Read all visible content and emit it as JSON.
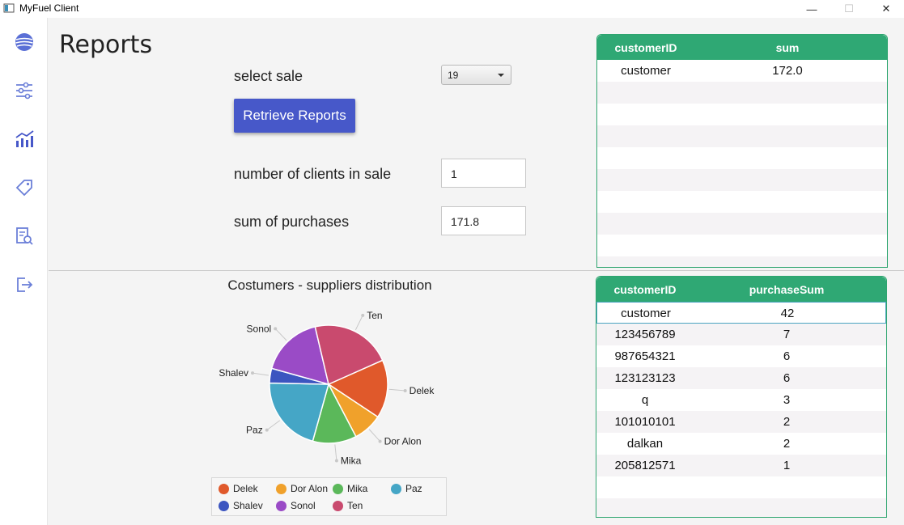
{
  "window": {
    "title": "MyFuel Client",
    "minimize": "—",
    "maximize": "☐",
    "close": "✕"
  },
  "sidebar": {
    "icons": [
      "globe-icon",
      "sliders-icon",
      "chart-icon",
      "tag-icon",
      "report-search-icon",
      "logout-icon"
    ],
    "active": "chart-icon",
    "icon_color": "#5a6fd6"
  },
  "page": {
    "title": "Reports",
    "select_sale_label": "select sale",
    "select_sale_value": "19",
    "retrieve_button": "Retrieve Reports",
    "clients_label": "number of clients in sale",
    "clients_value": "1",
    "sum_label": "sum of purchases",
    "sum_value": "171.8"
  },
  "top_table": {
    "columns": [
      "customerID",
      "sum"
    ],
    "rows": [
      [
        "customer",
        "172.0"
      ]
    ]
  },
  "bottom_table": {
    "columns": [
      "customerID",
      "purchaseSum"
    ],
    "rows": [
      [
        "customer",
        "42"
      ],
      [
        "123456789",
        "7"
      ],
      [
        "987654321",
        "6"
      ],
      [
        "123123123",
        "6"
      ],
      [
        "q",
        "3"
      ],
      [
        "101010101",
        "2"
      ],
      [
        "dalkan",
        "2"
      ],
      [
        "205812571",
        "1"
      ]
    ]
  },
  "chart_data": {
    "type": "pie",
    "title": "Costumers - suppliers distribution",
    "slices": [
      {
        "label": "Delek",
        "value": 16,
        "color": "#e0592b"
      },
      {
        "label": "Dor Alon",
        "value": 8,
        "color": "#f0a12b"
      },
      {
        "label": "Mika",
        "value": 12,
        "color": "#5bb85a"
      },
      {
        "label": "Paz",
        "value": 21,
        "color": "#45a6c6"
      },
      {
        "label": "Shalev",
        "value": 4,
        "color": "#3c55c0"
      },
      {
        "label": "Sonol",
        "value": 17,
        "color": "#9a4bc6"
      },
      {
        "label": "Ten",
        "value": 22,
        "color": "#c94a6e"
      }
    ],
    "legend": [
      "Delek",
      "Dor Alon",
      "Mika",
      "Paz",
      "Shalev",
      "Sonol",
      "Ten"
    ],
    "legend_position": "bottom"
  },
  "colors": {
    "accent": "#4758c9",
    "table_header": "#2fa874"
  }
}
